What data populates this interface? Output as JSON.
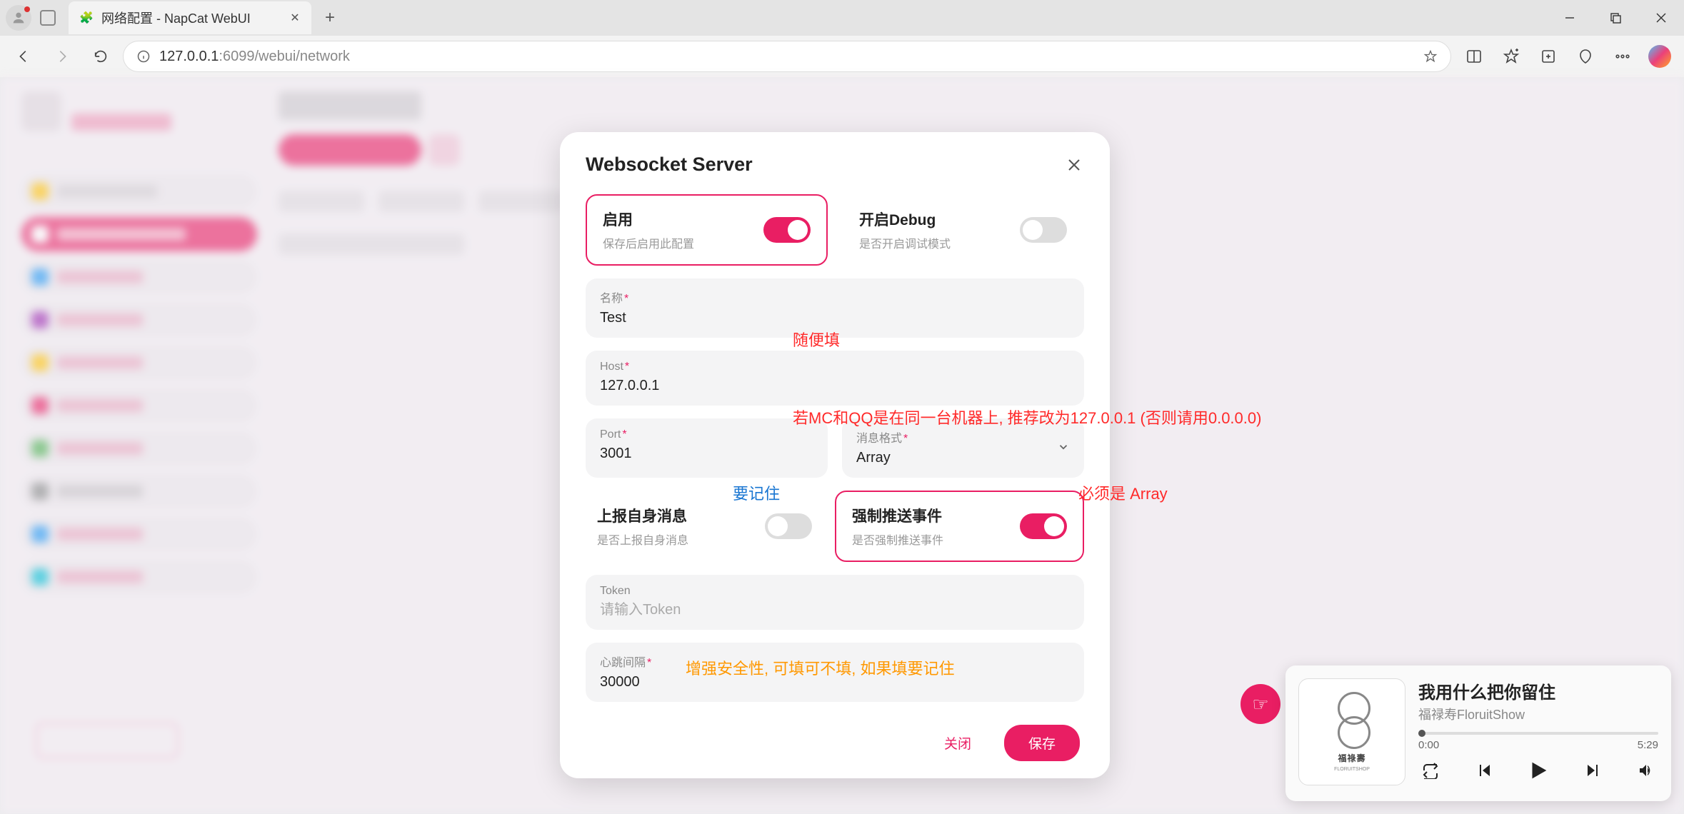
{
  "browser": {
    "tab_title": "网络配置 - NapCat WebUI",
    "url_host": "127.0.0.1",
    "url_rest": ":6099/webui/network"
  },
  "modal": {
    "title": "Websocket Server",
    "enable": {
      "label": "启用",
      "sub": "保存后启用此配置",
      "on": true
    },
    "debug": {
      "label": "开启Debug",
      "sub": "是否开启调试模式",
      "on": false
    },
    "name": {
      "label": "名称",
      "value": "Test"
    },
    "host": {
      "label": "Host",
      "value": "127.0.0.1"
    },
    "port": {
      "label": "Port",
      "value": "3001"
    },
    "msg_format": {
      "label": "消息格式",
      "value": "Array"
    },
    "report_self": {
      "label": "上报自身消息",
      "sub": "是否上报自身消息",
      "on": false
    },
    "force_push": {
      "label": "强制推送事件",
      "sub": "是否强制推送事件",
      "on": true
    },
    "token": {
      "label": "Token",
      "placeholder": "请输入Token"
    },
    "heartbeat": {
      "label": "心跳间隔",
      "value": "30000"
    },
    "footer": {
      "cancel": "关闭",
      "save": "保存"
    }
  },
  "annotations": {
    "name": "随便填",
    "host": "若MC和QQ是在同一台机器上, 推荐改为127.0.0.1 (否则请用0.0.0.0)",
    "port": "要记住",
    "array": "必须是 Array",
    "token": "增强安全性, 可填可不填, 如果填要记住"
  },
  "media": {
    "title": "我用什么把你留住",
    "artist": "福禄寿FloruitShow",
    "art_text": "福祿夀",
    "art_sub": "FLORUITSHOP",
    "elapsed": "0:00",
    "total": "5:29"
  }
}
